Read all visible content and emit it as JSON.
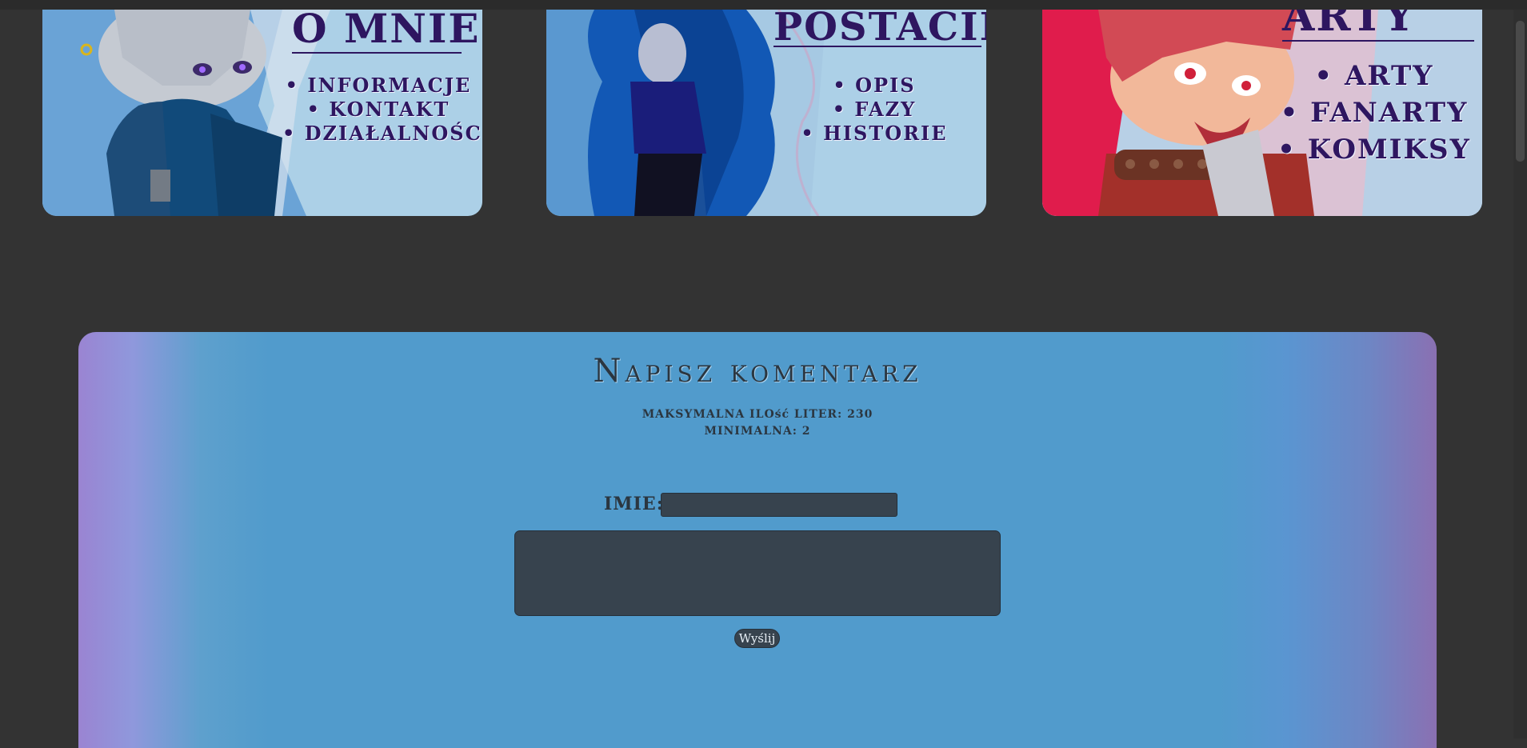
{
  "cards": [
    {
      "title": "O MNIE",
      "items": [
        "INFORMACJE",
        "KONTAKT",
        "DZIAŁALNOŚC"
      ]
    },
    {
      "title": "POSTACIE",
      "items": [
        "OPIS",
        "FAZY",
        "HISTORIE"
      ]
    },
    {
      "title": "ARTY",
      "items": [
        "ARTY",
        "FANARTY",
        "KOMIKSY"
      ]
    }
  ],
  "comment_form": {
    "title": "Napisz komentarz",
    "max_letters": "MAKSYMALNA ILOść LITER: 230",
    "min_letters": "MINIMALNA: 2",
    "name_label": "IMIE:",
    "name_value": "",
    "comment_value": "",
    "send_label": "Wyślij"
  },
  "colors": {
    "page_background": "#333333",
    "card_text": "#2e1660",
    "panel_blue": "#519bcc",
    "panel_purple": "#9a84d2",
    "field_background": "#37434e"
  }
}
